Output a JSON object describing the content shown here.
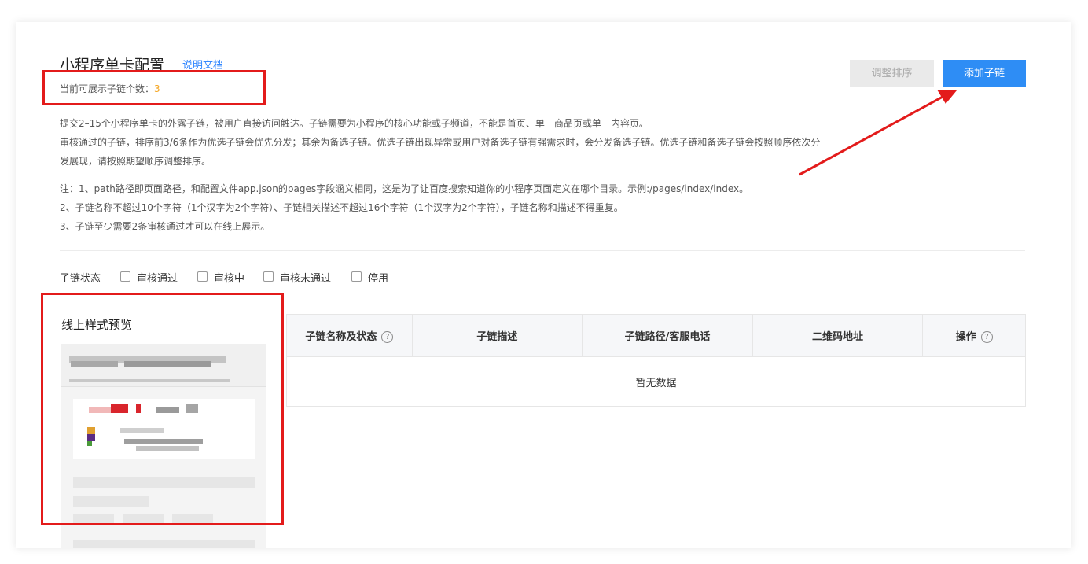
{
  "header": {
    "title": "小程序单卡配置",
    "doc_link": "说明文档",
    "count_label": "当前可展示子链个数：",
    "count_value": "3"
  },
  "buttons": {
    "sort": "调整排序",
    "add": "添加子链"
  },
  "description": {
    "line1": "提交2–15个小程序单卡的外露子链，被用户直接访问触达。子链需要为小程序的核心功能或子频道，不能是首页、单一商品页或单一内容页。",
    "line2": "审核通过的子链，排序前3/6条作为优选子链会优先分发；其余为备选子链。优选子链出现异常或用户对备选子链有强需求时，会分发备选子链。优选子链和备选子链会按照顺序依次分",
    "line3": "发展现，请按照期望顺序调整排序。",
    "note1": "注：1、path路径即页面路径，和配置文件app.json的pages字段涵义相同，这是为了让百度搜索知道你的小程序页面定义在哪个目录。示例:/pages/index/index。",
    "note2": "2、子链名称不超过10个字符（1个汉字为2个字符）、子链相关描述不超过16个字符（1个汉字为2个字符），子链名称和描述不得重复。",
    "note3": "3、子链至少需要2条审核通过才可以在线上展示。"
  },
  "filter": {
    "label": "子链状态",
    "options": [
      "审核通过",
      "审核中",
      "审核未通过",
      "停用"
    ]
  },
  "preview": {
    "title": "线上样式预览"
  },
  "table": {
    "columns": [
      "子链名称及状态",
      "子链描述",
      "子链路径/客服电话",
      "二维码地址",
      "操作"
    ],
    "empty_text": "暂无数据"
  },
  "icons": {
    "help": "question-circle-icon"
  },
  "colors": {
    "accent": "#2e8df5",
    "count": "#f5a623",
    "annotation": "#e31b1b"
  }
}
